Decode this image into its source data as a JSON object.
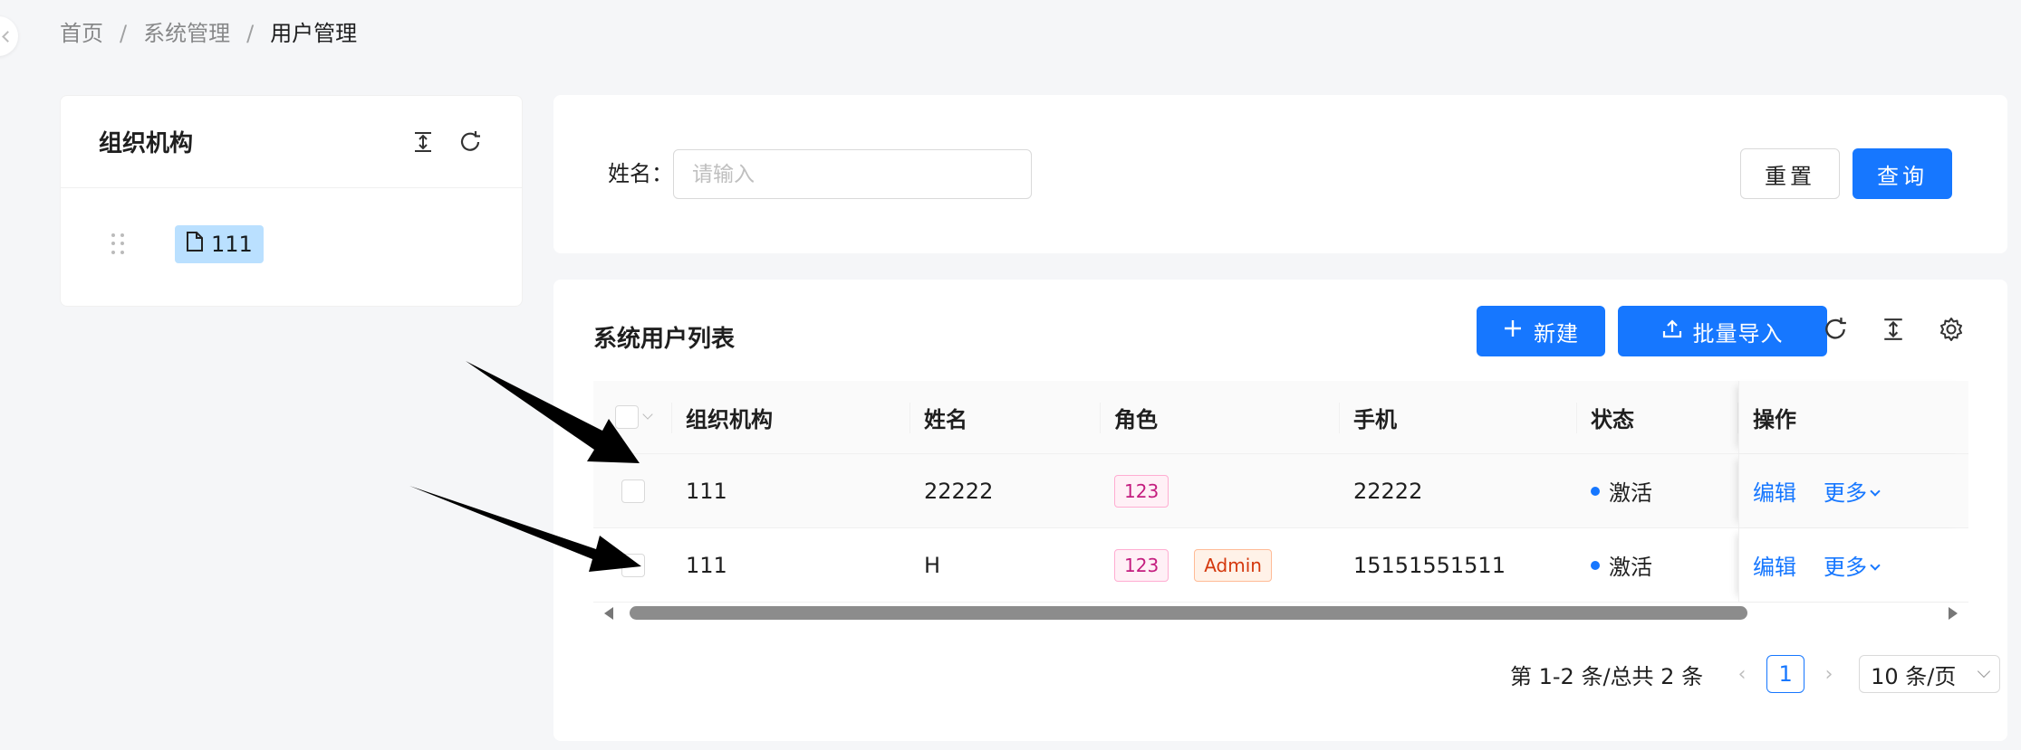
{
  "breadcrumb": [
    "首页",
    "系统管理",
    "用户管理"
  ],
  "org_panel": {
    "title": "组织机构",
    "tree": [
      {
        "label": "111",
        "icon": "file-icon"
      }
    ]
  },
  "search": {
    "name_label": "姓名：",
    "name_placeholder": "请输入",
    "name_value": "",
    "reset_label": "重置",
    "query_label": "查询"
  },
  "table": {
    "title": "系统用户列表",
    "new_label": "新建",
    "import_label": "批量导入",
    "columns": [
      "组织机构",
      "姓名",
      "角色",
      "手机",
      "状态",
      "操作"
    ],
    "rows": [
      {
        "org": "111",
        "name": "22222",
        "roles": [
          "123"
        ],
        "phone": "22222",
        "status": "激活",
        "edit": "编辑",
        "more": "更多"
      },
      {
        "org": "111",
        "name": "H",
        "roles": [
          "123",
          "Admin"
        ],
        "phone": "15151551511",
        "status": "激活",
        "edit": "编辑",
        "more": "更多"
      }
    ]
  },
  "pagination": {
    "total_text": "第 1-2 条/总共 2 条",
    "current_page": "1",
    "page_size": "10 条/页"
  },
  "colors": {
    "primary": "#1677ff",
    "tag_magenta": "#c41d7f",
    "tag_orange": "#d4380d",
    "tree_selected": "#bae0ff"
  }
}
